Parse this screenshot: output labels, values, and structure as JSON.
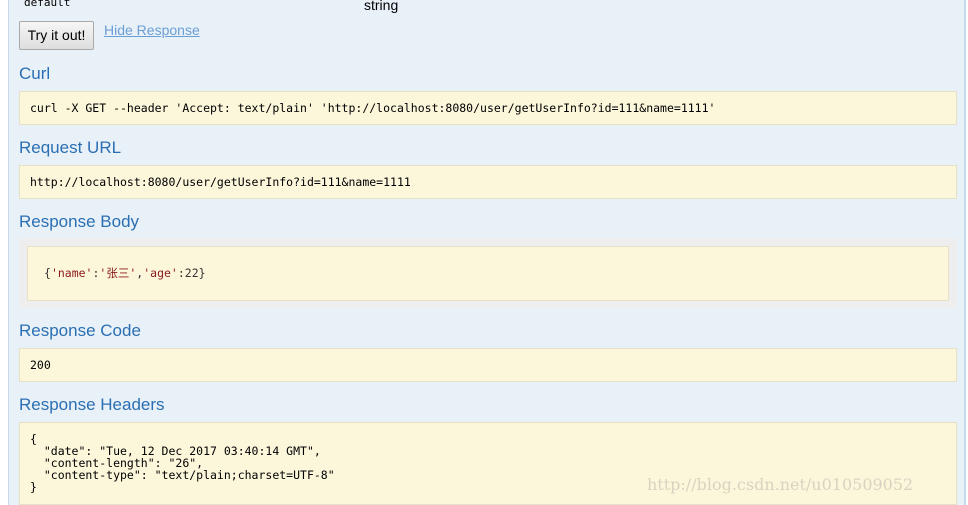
{
  "parameter": {
    "name": "default",
    "type": "string"
  },
  "actions": {
    "try_label": "Try it out!",
    "hide_label": "Hide Response"
  },
  "curl": {
    "title": "Curl",
    "command": "curl -X GET --header 'Accept: text/plain' 'http://localhost:8080/user/getUserInfo?id=111&name=1111'"
  },
  "request_url": {
    "title": "Request URL",
    "value": "http://localhost:8080/user/getUserInfo?id=111&name=1111"
  },
  "response_body": {
    "title": "Response Body",
    "open": "{",
    "key1": "'name'",
    "sep1": ":",
    "val1": "'张三'",
    "comma": ",",
    "key2": "'age'",
    "sep2": ":",
    "val2": "22",
    "close": "}"
  },
  "response_code": {
    "title": "Response Code",
    "value": "200"
  },
  "response_headers": {
    "title": "Response Headers",
    "text": "{\n  \"date\": \"Tue, 12 Dec 2017 03:40:14 GMT\",\n  \"content-length\": \"26\",\n  \"content-type\": \"text/plain;charset=UTF-8\"\n}"
  },
  "watermark": "http://blog.csdn.net/u010509052",
  "colors": {
    "panel_bg": "#e8f0f8",
    "heading": "#2b6fb3",
    "link": "#6c9ed6",
    "code_bg": "#fcf6db"
  }
}
